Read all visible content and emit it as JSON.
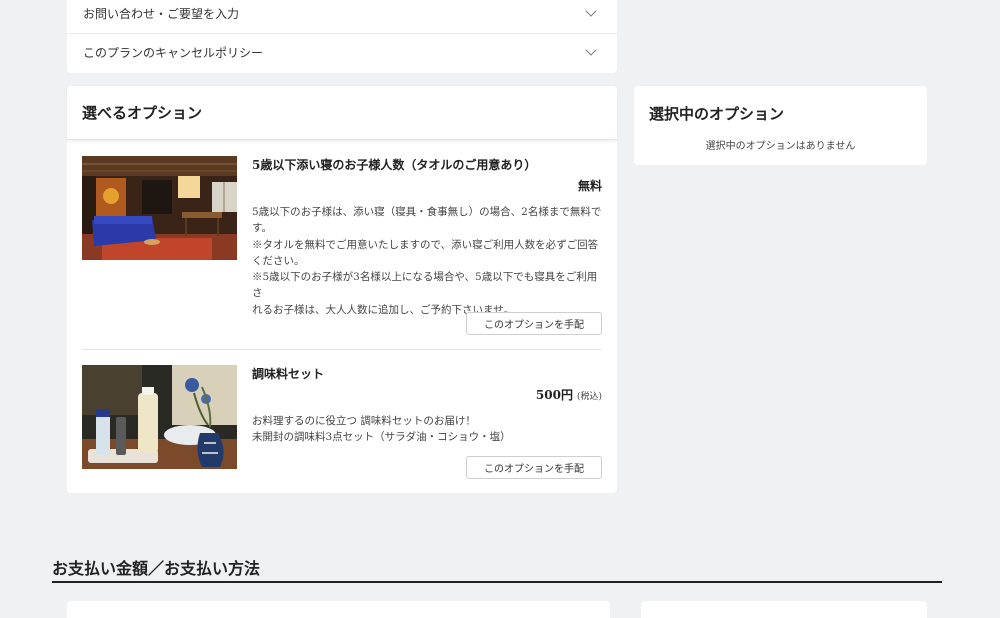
{
  "accordion": {
    "items": [
      {
        "label": "お問い合わせ・ご要望を入力"
      },
      {
        "label": "このプランのキャンセルポリシー"
      }
    ]
  },
  "options": {
    "title": "選べるオプション",
    "items": [
      {
        "title": "5歳以下添い寝のお子様人数（タオルのご用意あり）",
        "price": "無料",
        "tax": "",
        "description": [
          "5歳以下のお子様は、添い寝（寝具・食事無し）の場合、2名様まで無料で",
          "す。",
          "※タオルを無料でご用意いたしますので、添い寝ご利用人数を必ずご回答",
          "ください。",
          "※5歳以下のお子様が3名様以上になる場合や、5歳以下でも寝具をご利用さ",
          "れるお子様は、大人人数に追加し、ご予約下さいませ。"
        ],
        "button": "このオプションを手配",
        "image": "room-interior-photo"
      },
      {
        "title": "調味料セット",
        "price": "500円",
        "tax": "(税込)",
        "description": [
          "お料理するのに役立つ 調味料セットのお届け！",
          "未開封の調味料3点セット（サラダ油・コショウ・塩）"
        ],
        "button": "このオプションを手配",
        "image": "seasoning-set-photo"
      }
    ]
  },
  "selected": {
    "title": "選択中のオプション",
    "empty_message": "選択中のオプションはありません"
  },
  "payment": {
    "heading": "お支払い金額／お支払い方法"
  }
}
